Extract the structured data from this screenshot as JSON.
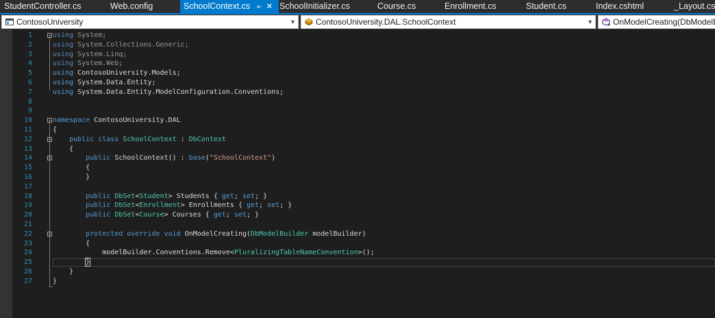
{
  "tabs": [
    {
      "label": "StudentController.cs",
      "active": false
    },
    {
      "label": "Web.config",
      "active": false
    },
    {
      "label": "SchoolContext.cs",
      "active": true
    },
    {
      "label": "SchoolInitializer.cs",
      "active": false
    },
    {
      "label": "Course.cs",
      "active": false
    },
    {
      "label": "Enrollment.cs",
      "active": false
    },
    {
      "label": "Student.cs",
      "active": false
    },
    {
      "label": "Index.cshtml",
      "active": false
    },
    {
      "label": "_Layout.cshtml",
      "active": false
    }
  ],
  "tab_icons": {
    "pin": "pin-icon",
    "close": "close-icon"
  },
  "navbar": {
    "project": "ContosoUniversity",
    "type": "ContosoUniversity.DAL.SchoolContext",
    "member": "OnModelCreating(DbModelBuilder modelBuilder)"
  },
  "colors": {
    "accent": "#007acc",
    "keyword": "#569cd6",
    "type": "#4ec9b0",
    "string": "#d69d85",
    "line_number": "#2b91af"
  },
  "lines": [
    {
      "n": "1",
      "tokens": [
        [
          "using",
          "kw g"
        ],
        [
          " System;",
          "pl g"
        ]
      ]
    },
    {
      "n": "2",
      "tokens": [
        [
          "using",
          "kw g"
        ],
        [
          " System.Collections.Generic;",
          "pl g"
        ]
      ]
    },
    {
      "n": "3",
      "tokens": [
        [
          "using",
          "kw g"
        ],
        [
          " System.Linq;",
          "pl g"
        ]
      ]
    },
    {
      "n": "4",
      "tokens": [
        [
          "using",
          "kw g"
        ],
        [
          " System.Web;",
          "pl g"
        ]
      ]
    },
    {
      "n": "5",
      "tokens": [
        [
          "using",
          "kw"
        ],
        [
          " ContosoUniversity.Models;",
          "pl"
        ]
      ]
    },
    {
      "n": "6",
      "tokens": [
        [
          "using",
          "kw"
        ],
        [
          " System.Data.Entity;",
          "pl"
        ]
      ]
    },
    {
      "n": "7",
      "tokens": [
        [
          "using",
          "kw"
        ],
        [
          " System.Data.Entity.ModelConfiguration.Conventions;",
          "pl"
        ]
      ]
    },
    {
      "n": "8",
      "tokens": []
    },
    {
      "n": "9",
      "tokens": []
    },
    {
      "n": "10",
      "tokens": [
        [
          "namespace",
          "kw"
        ],
        [
          " ContosoUniversity.DAL",
          "pl"
        ]
      ]
    },
    {
      "n": "11",
      "tokens": [
        [
          "{",
          "pl"
        ]
      ]
    },
    {
      "n": "12",
      "tokens": [
        [
          "    ",
          "pl"
        ],
        [
          "public",
          "kw"
        ],
        [
          " ",
          "pl"
        ],
        [
          "class",
          "kw"
        ],
        [
          " ",
          "pl"
        ],
        [
          "SchoolContext",
          "ty"
        ],
        [
          " : ",
          "pl"
        ],
        [
          "DbContext",
          "ty"
        ]
      ]
    },
    {
      "n": "13",
      "tokens": [
        [
          "    {",
          "pl"
        ]
      ]
    },
    {
      "n": "14",
      "tokens": [
        [
          "        ",
          "pl"
        ],
        [
          "public",
          "kw"
        ],
        [
          " SchoolContext() : ",
          "pl"
        ],
        [
          "base",
          "kw"
        ],
        [
          "(",
          "pl"
        ],
        [
          "\"SchoolContext\"",
          "str"
        ],
        [
          ")",
          "pl"
        ]
      ]
    },
    {
      "n": "15",
      "tokens": [
        [
          "        {",
          "pl"
        ]
      ]
    },
    {
      "n": "16",
      "tokens": [
        [
          "        }",
          "pl"
        ]
      ]
    },
    {
      "n": "17",
      "tokens": []
    },
    {
      "n": "18",
      "tokens": [
        [
          "        ",
          "pl"
        ],
        [
          "public",
          "kw"
        ],
        [
          " ",
          "pl"
        ],
        [
          "DbSet",
          "ty"
        ],
        [
          "<",
          "pl"
        ],
        [
          "Student",
          "ty"
        ],
        [
          "> Students { ",
          "pl"
        ],
        [
          "get",
          "kw"
        ],
        [
          "; ",
          "pl"
        ],
        [
          "set",
          "kw"
        ],
        [
          "; }",
          "pl"
        ]
      ]
    },
    {
      "n": "19",
      "tokens": [
        [
          "        ",
          "pl"
        ],
        [
          "public",
          "kw"
        ],
        [
          " ",
          "pl"
        ],
        [
          "DbSet",
          "ty"
        ],
        [
          "<",
          "pl"
        ],
        [
          "Enrollment",
          "ty"
        ],
        [
          "> Enrollments { ",
          "pl"
        ],
        [
          "get",
          "kw"
        ],
        [
          "; ",
          "pl"
        ],
        [
          "set",
          "kw"
        ],
        [
          "; }",
          "pl"
        ]
      ]
    },
    {
      "n": "20",
      "tokens": [
        [
          "        ",
          "pl"
        ],
        [
          "public",
          "kw"
        ],
        [
          " ",
          "pl"
        ],
        [
          "DbSet",
          "ty"
        ],
        [
          "<",
          "pl"
        ],
        [
          "Course",
          "ty"
        ],
        [
          "> Courses { ",
          "pl"
        ],
        [
          "get",
          "kw"
        ],
        [
          "; ",
          "pl"
        ],
        [
          "set",
          "kw"
        ],
        [
          "; }",
          "pl"
        ]
      ]
    },
    {
      "n": "21",
      "tokens": []
    },
    {
      "n": "22",
      "tokens": [
        [
          "        ",
          "pl"
        ],
        [
          "protected",
          "kw"
        ],
        [
          " ",
          "pl"
        ],
        [
          "override",
          "kw"
        ],
        [
          " ",
          "pl"
        ],
        [
          "void",
          "kw"
        ],
        [
          " OnModelCreating(",
          "pl"
        ],
        [
          "DbModelBuilder",
          "ty"
        ],
        [
          " modelBuilder)",
          "pl"
        ]
      ]
    },
    {
      "n": "23",
      "tokens": [
        [
          "        {",
          "pl"
        ]
      ]
    },
    {
      "n": "24",
      "tokens": [
        [
          "            modelBuilder.Conventions.Remove<",
          "pl"
        ],
        [
          "PluralizingTableNameConvention",
          "ty"
        ],
        [
          ">();",
          "pl"
        ]
      ]
    },
    {
      "n": "25",
      "tokens": [
        [
          "        ",
          "pl"
        ],
        [
          "}",
          "pl caret"
        ]
      ]
    },
    {
      "n": "26",
      "tokens": [
        [
          "    }",
          "pl"
        ]
      ]
    },
    {
      "n": "27",
      "tokens": [
        [
          "}",
          "pl"
        ]
      ]
    }
  ]
}
